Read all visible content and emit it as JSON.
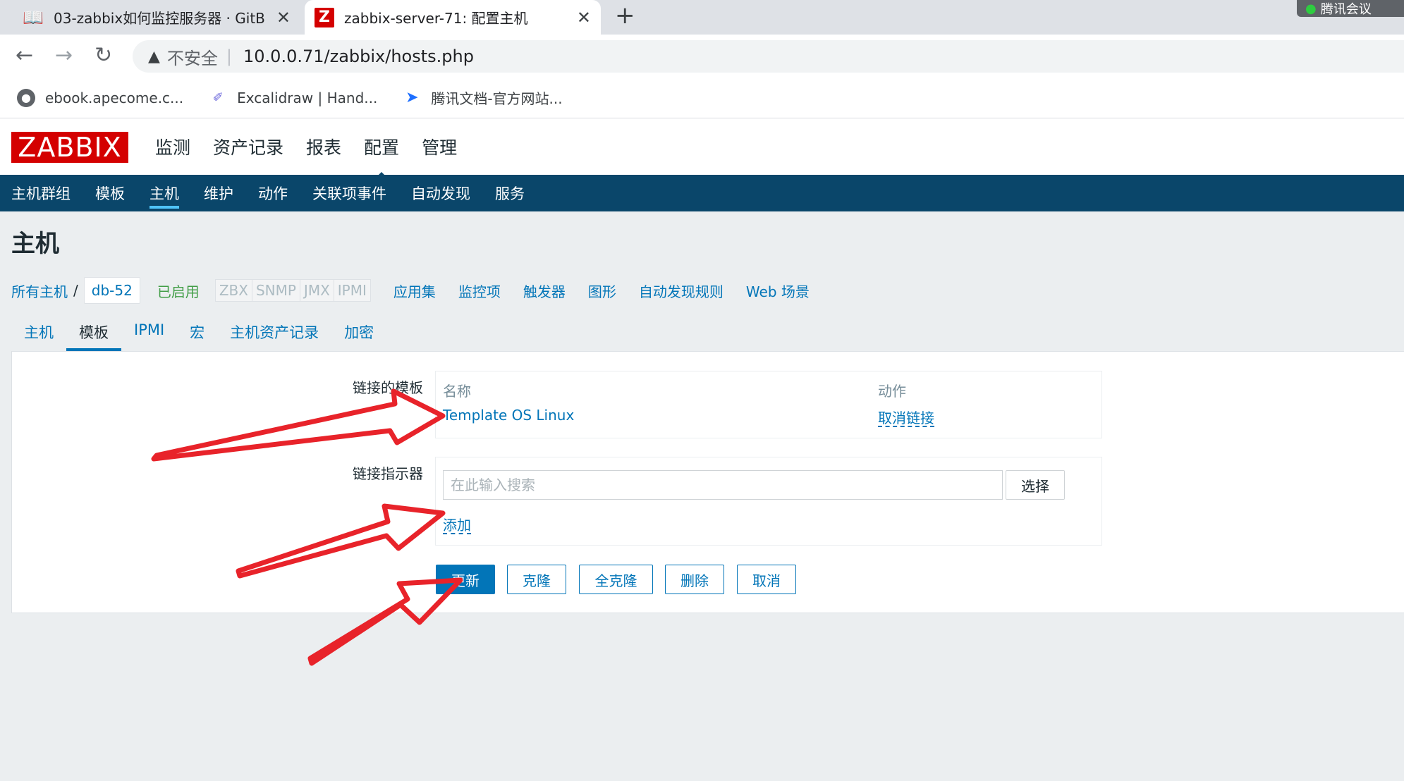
{
  "browser": {
    "tabs": [
      {
        "title": "03-zabbix如何监控服务器 · GitB",
        "icon": "book-icon"
      },
      {
        "title": "zabbix-server-71: 配置主机",
        "icon": "zabbix-favicon"
      }
    ],
    "tab_close": "✕",
    "new_tab": "+",
    "meeting_badge": "腾讯会议",
    "security_label": "不安全",
    "url": "10.0.0.71/zabbix/hosts.php",
    "bookmarks": [
      {
        "label": "ebook.apecome.c...",
        "icon": "globe-icon"
      },
      {
        "label": "Excalidraw | Hand...",
        "icon": "excalidraw-icon"
      },
      {
        "label": "腾讯文档-官方网站...",
        "icon": "tencent-docs-icon"
      }
    ]
  },
  "zabbix": {
    "logo": "ZABBIX",
    "main_menu": [
      "监测",
      "资产记录",
      "报表",
      "配置",
      "管理"
    ],
    "main_menu_active": "配置",
    "sub_menu": [
      "主机群组",
      "模板",
      "主机",
      "维护",
      "动作",
      "关联项事件",
      "自动发现",
      "服务"
    ],
    "sub_menu_active": "主机",
    "page_title": "主机",
    "breadcrumb": {
      "all_hosts": "所有主机",
      "separator": "/",
      "host": "db-52",
      "status": "已启用",
      "availability": [
        "ZBX",
        "SNMP",
        "JMX",
        "IPMI"
      ],
      "links": [
        "应用集",
        "监控项",
        "触发器",
        "图形",
        "自动发现规则",
        "Web 场景"
      ]
    },
    "form_tabs": [
      "主机",
      "模板",
      "IPMI",
      "宏",
      "主机资产记录",
      "加密"
    ],
    "form_tab_active": "模板",
    "linked_templates": {
      "label": "链接的模板",
      "col_name": "名称",
      "col_action": "动作",
      "rows": [
        {
          "name": "Template OS Linux",
          "action": "取消链接"
        }
      ]
    },
    "link_new": {
      "label": "链接指示器",
      "search_placeholder": "在此输入搜索",
      "select_button": "选择",
      "add_link": "添加"
    },
    "buttons": {
      "update": "更新",
      "clone": "克隆",
      "full_clone": "全克隆",
      "delete": "删除",
      "cancel": "取消"
    }
  },
  "colors": {
    "zabbix_red": "#d40000",
    "nav_dark": "#0a466a",
    "link_blue": "#0275b8",
    "enabled_green": "#429e47",
    "annotation_red": "#e8232a"
  }
}
